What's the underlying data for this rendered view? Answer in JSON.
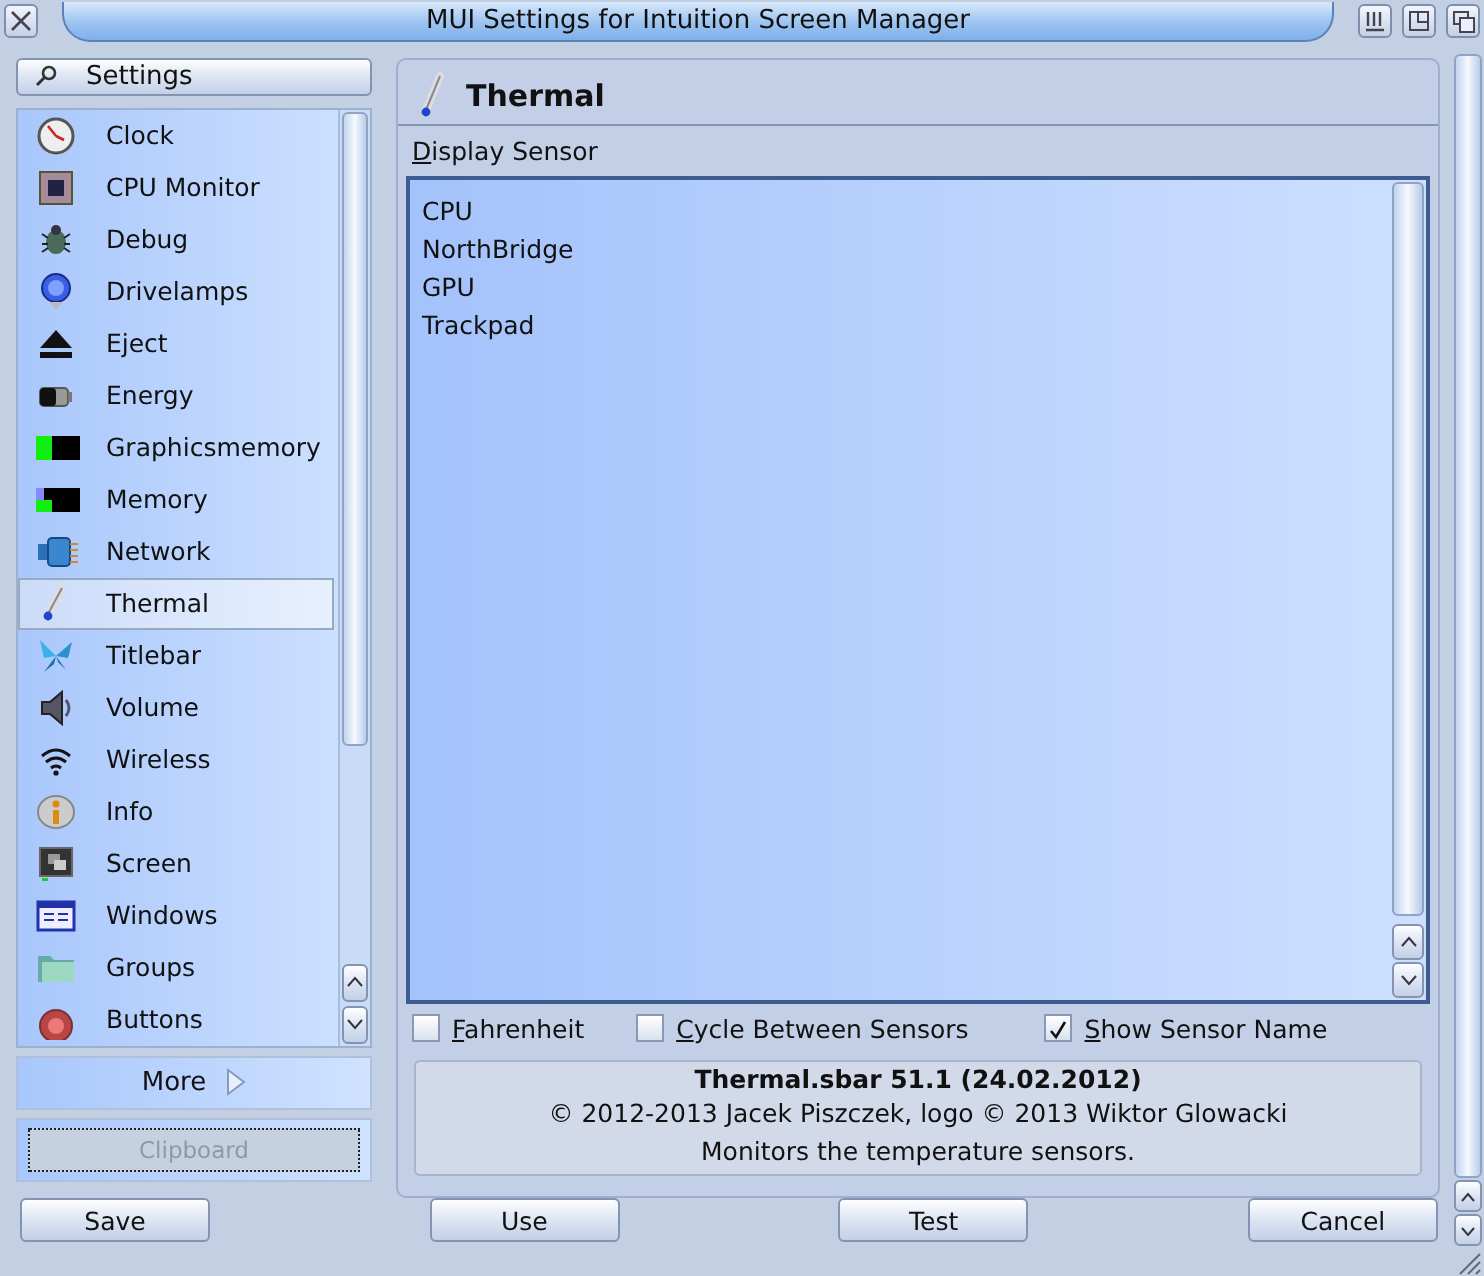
{
  "window": {
    "title": "MUI Settings for Intuition Screen Manager"
  },
  "sidebar": {
    "header_button": {
      "label": "Settings"
    },
    "items": [
      {
        "label": "Clock",
        "selected": false
      },
      {
        "label": "CPU Monitor",
        "selected": false
      },
      {
        "label": "Debug",
        "selected": false
      },
      {
        "label": "Drivelamps",
        "selected": false
      },
      {
        "label": "Eject",
        "selected": false
      },
      {
        "label": "Energy",
        "selected": false
      },
      {
        "label": "Graphicsmemory",
        "selected": false
      },
      {
        "label": "Memory",
        "selected": false
      },
      {
        "label": "Network",
        "selected": false
      },
      {
        "label": "Thermal",
        "selected": true
      },
      {
        "label": "Titlebar",
        "selected": false
      },
      {
        "label": "Volume",
        "selected": false
      },
      {
        "label": "Wireless",
        "selected": false
      },
      {
        "label": "Info",
        "selected": false
      },
      {
        "label": "Screen",
        "selected": false
      },
      {
        "label": "Windows",
        "selected": false
      },
      {
        "label": "Groups",
        "selected": false
      },
      {
        "label": "Buttons",
        "selected": false
      }
    ],
    "more_button": {
      "label": "More"
    },
    "clipboard_button": {
      "label": "Clipboard",
      "disabled": true
    }
  },
  "panel": {
    "title": "Thermal",
    "list_label": "Display Sensor",
    "sensors": [
      "CPU",
      "NorthBridge",
      "GPU",
      "Trackpad"
    ],
    "options": [
      {
        "label": "Fahrenheit",
        "checked": false
      },
      {
        "label": "Cycle Between Sensors",
        "checked": false
      },
      {
        "label": "Show Sensor Name",
        "checked": true
      }
    ],
    "info": {
      "name": "Thermal.sbar 51.1 (24.02.2012)",
      "copyright": "© 2012-2013 Jacek Piszczek, logo © 2013 Wiktor Glowacki",
      "description": "Monitors the temperature sensors."
    }
  },
  "buttons": [
    "Save",
    "Use",
    "Test",
    "Cancel"
  ]
}
